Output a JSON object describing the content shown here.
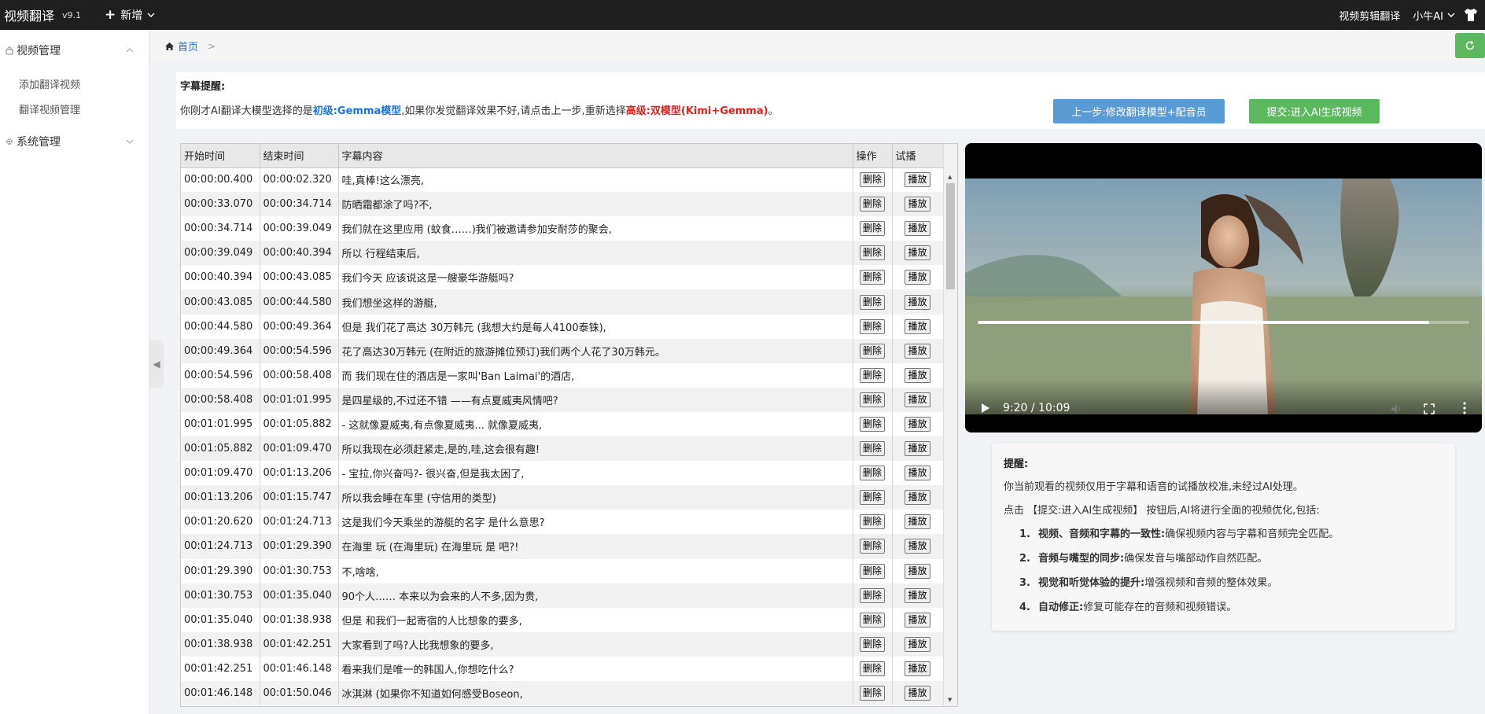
{
  "topbar": {
    "brand": "视频翻译",
    "version": "v9.1",
    "new_label": "新增",
    "right_link": "视频剪辑翻译",
    "user": "小牛AI"
  },
  "sidebar": {
    "groups": [
      {
        "label": "视频管理",
        "items": [
          "添加翻译视频",
          "翻译视频管理"
        ]
      },
      {
        "label": "系统管理",
        "items": []
      }
    ]
  },
  "breadcrumb": {
    "home": "首页",
    "sep": ">"
  },
  "notice": {
    "title": "字幕提醒:",
    "text_1": "你刚才AI翻译大模型选择的是",
    "level_basic": "初级:Gemma模型",
    "text_2": ",如果你发觉翻译效果不好,请点击上一步,重新选择",
    "level_advanced": "高级:双模型(Kimi+Gemma)",
    "text_3": "。",
    "btn_prev": "上一步:修改翻译模型+配音员",
    "btn_submit": "提交:进入AI生成视频"
  },
  "table": {
    "headers": [
      "开始时间",
      "结束时间",
      "字幕内容",
      "操作",
      "试播"
    ],
    "delete_label": "删除",
    "play_label": "播放",
    "rows": [
      [
        "00:00:00.400",
        "00:00:02.320",
        "哇,真棒!这么漂亮,"
      ],
      [
        "00:00:33.070",
        "00:00:34.714",
        "防晒霜都涂了吗?不,"
      ],
      [
        "00:00:34.714",
        "00:00:39.049",
        "我们就在这里应用 (蚊食……)我们被邀请参加安耐莎的聚会,"
      ],
      [
        "00:00:39.049",
        "00:00:40.394",
        "所以 行程结束后,"
      ],
      [
        "00:00:40.394",
        "00:00:43.085",
        "我们今天 应该说这是一艘豪华游艇吗?"
      ],
      [
        "00:00:43.085",
        "00:00:44.580",
        "我们想坐这样的游艇,"
      ],
      [
        "00:00:44.580",
        "00:00:49.364",
        "但是 我们花了高达 30万韩元 (我想大约是每人4100泰铢),"
      ],
      [
        "00:00:49.364",
        "00:00:54.596",
        "花了高达30万韩元 (在附近的旅游摊位预订)我们两个人花了30万韩元。"
      ],
      [
        "00:00:54.596",
        "00:00:58.408",
        "而 我们现在住的酒店是一家叫'Ban Laimai'的酒店,"
      ],
      [
        "00:00:58.408",
        "00:01:01.995",
        "是四星级的,不过还不错 ——有点夏威夷风情吧?"
      ],
      [
        "00:01:01.995",
        "00:01:05.882",
        "- 这就像夏威夷,有点像夏威夷... 就像夏威夷,"
      ],
      [
        "00:01:05.882",
        "00:01:09.470",
        "所以我现在必须赶紧走,是的,哇,这会很有趣!"
      ],
      [
        "00:01:09.470",
        "00:01:13.206",
        "- 宝拉,你兴奋吗?- 很兴奋,但是我太困了,"
      ],
      [
        "00:01:13.206",
        "00:01:15.747",
        "所以我会睡在车里 (守信用的类型)"
      ],
      [
        "00:01:20.620",
        "00:01:24.713",
        "这是我们今天乘坐的游艇的名字 是什么意思?"
      ],
      [
        "00:01:24.713",
        "00:01:29.390",
        "在海里 玩 (在海里玩) 在海里玩 是 吧?!"
      ],
      [
        "00:01:29.390",
        "00:01:30.753",
        "不,啥啥,"
      ],
      [
        "00:01:30.753",
        "00:01:35.040",
        "90个人…… 本来以为会来的人不多,因为贵,"
      ],
      [
        "00:01:35.040",
        "00:01:38.938",
        "但是 和我们一起寄宿的人比想象的要多,"
      ],
      [
        "00:01:38.938",
        "00:01:42.251",
        "大家看到了吗?人比我想象的要多,"
      ],
      [
        "00:01:42.251",
        "00:01:46.148",
        "看来我们是唯一的韩国人,你想吃什么?"
      ],
      [
        "00:01:46.148",
        "00:01:50.046",
        "冰淇淋 (如果你不知道如何感受Boseon,"
      ]
    ]
  },
  "video": {
    "time": "9:20 / 10:09",
    "progress": 0.918
  },
  "tips": {
    "title": "提醒:",
    "line_1": "你当前观看的视频仅用于字幕和语音的试播放校准,未经过AI处理。",
    "line_2": "点击 【提交:进入AI生成视频】 按钮后,AI将进行全面的视频优化,包括:",
    "items": [
      {
        "num": "1.",
        "bold": "视频、音频和字幕的一致性:",
        "text": "确保视频内容与字幕和音频完全匹配。"
      },
      {
        "num": "2.",
        "bold": "音频与嘴型的同步:",
        "text": "确保发音与嘴部动作自然匹配。"
      },
      {
        "num": "3.",
        "bold": "视觉和听觉体验的提升:",
        "text": "增强视频和音频的整体效果。"
      },
      {
        "num": "4.",
        "bold": "自动修正:",
        "text": "修复可能存在的音频和视频错误。"
      }
    ]
  }
}
